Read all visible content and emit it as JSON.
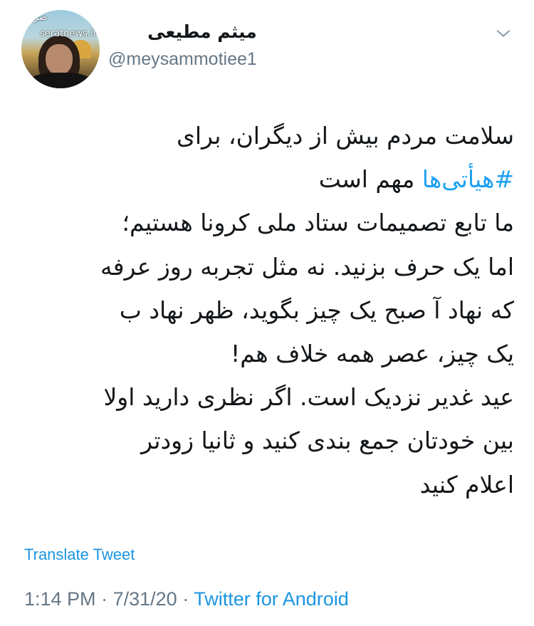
{
  "author": {
    "display_name": "میثم مطیعی",
    "handle": "@meysammotiee1",
    "avatar_watermark": "seratnews.ir",
    "avatar_logo": "صراط"
  },
  "tweet": {
    "lines": [
      "سلامت مردم بیش از دیگران، برای",
      "مهم است",
      "ما تابع تصمیمات ستاد ملی کرونا هستیم؛",
      "اما یک حرف بزنید. نه مثل تجربه روز عرفه",
      "که نهاد آ صبح یک چیز بگوید، ظهر نهاد ب",
      "یک چیز، عصر همه خلاف هم!",
      "عید غدیر نزدیک است. اگر نظری دارید اولا",
      "بین خودتان جمع بندی کنید و ثانیا زودتر",
      "اعلام کنید"
    ],
    "hashtag": "#هیأتی‌ها"
  },
  "actions": {
    "translate_label": "Translate Tweet"
  },
  "meta": {
    "time": "1:14 PM",
    "date": "7/31/20",
    "separator": "·",
    "source": "Twitter for Android"
  },
  "icons": {
    "menu": "chevron-down-icon"
  },
  "colors": {
    "link": "#1b95e0",
    "secondary_text": "#657786",
    "primary_text": "#14171a"
  }
}
